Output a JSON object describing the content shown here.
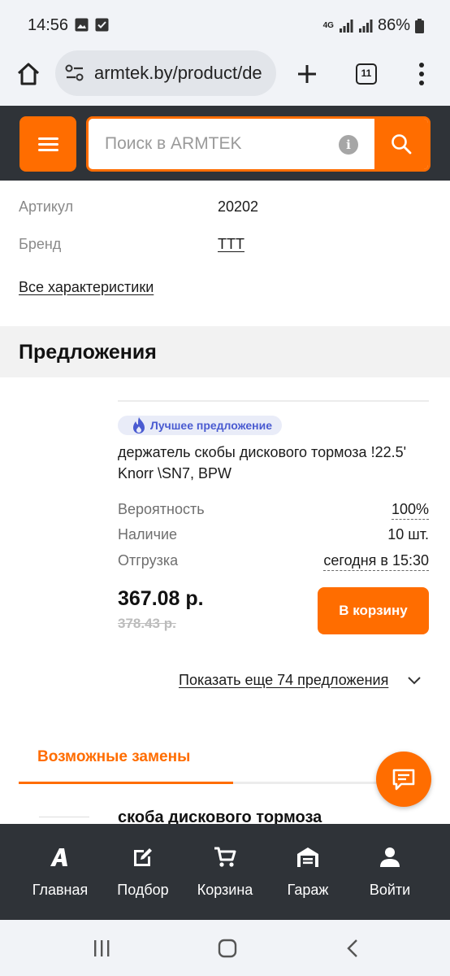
{
  "status_bar": {
    "time": "14:56",
    "network": "4G",
    "battery": "86%"
  },
  "browser": {
    "url": "armtek.by/product/de",
    "tab_count": "11"
  },
  "header": {
    "search_placeholder": "Поиск в ARMTEK"
  },
  "specs": {
    "article_label": "Артикул",
    "article_value": "20202",
    "brand_label": "Бренд",
    "brand_value": "TTT",
    "all_specs_link": "Все характеристики"
  },
  "offers": {
    "title": "Предложения",
    "best_badge": "Лучшее предложение",
    "product_name": "держатель скобы дискового тормоза !22.5' Knorr \\SN7, BPW",
    "probability_label": "Вероятность",
    "probability_value": "100%",
    "availability_label": "Наличие",
    "availability_value": "10 шт.",
    "shipment_label": "Отгрузка",
    "shipment_value": "сегодня в 15:30",
    "price": "367.08 р.",
    "old_price": "378.43 р.",
    "cart_button": "В корзину",
    "show_more": "Показать еще 74 предложения"
  },
  "replacements": {
    "tab_label": "Возможные замены",
    "first_item_name": "скоба дискового тормоза"
  },
  "bottom_nav": [
    {
      "label": "Главная",
      "icon": "home-logo-icon"
    },
    {
      "label": "Подбор",
      "icon": "edit-icon"
    },
    {
      "label": "Корзина",
      "icon": "cart-icon"
    },
    {
      "label": "Гараж",
      "icon": "garage-icon"
    },
    {
      "label": "Войти",
      "icon": "user-icon"
    }
  ],
  "colors": {
    "accent": "#ff6d00",
    "header_bg": "#2f3338",
    "badge_text": "#4a5bd1"
  }
}
